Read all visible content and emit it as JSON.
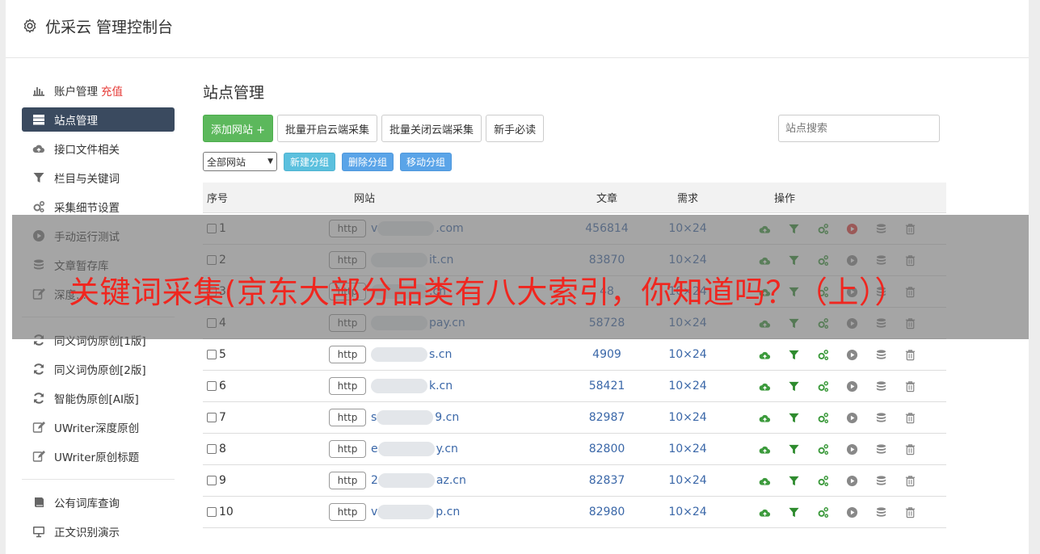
{
  "app": {
    "title": "优采云 管理控制台"
  },
  "sidebar": {
    "group1": [
      {
        "label": "账户管理",
        "extra": "充值",
        "icon": "bar-chart-icon"
      },
      {
        "label": "站点管理",
        "icon": "server-icon",
        "active": true
      },
      {
        "label": "接口文件相关",
        "icon": "cloud-icon"
      },
      {
        "label": "栏目与关键词",
        "icon": "filter-icon"
      },
      {
        "label": "采集细节设置",
        "icon": "gears-icon"
      },
      {
        "label": "手动运行测试",
        "icon": "play-icon"
      },
      {
        "label": "文章暂存库",
        "icon": "database-icon"
      },
      {
        "label": "深度...",
        "icon": "edit-icon"
      }
    ],
    "group2": [
      {
        "label": "同义词伪原创[1版]",
        "icon": "refresh-icon"
      },
      {
        "label": "同义词伪原创[2版]",
        "icon": "refresh-icon"
      },
      {
        "label": "智能伪原创[AI版]",
        "icon": "refresh-icon"
      },
      {
        "label": "UWriter深度原创",
        "icon": "edit-icon"
      },
      {
        "label": "UWriter原创标题",
        "icon": "edit-icon"
      }
    ],
    "group3": [
      {
        "label": "公有词库查询",
        "icon": "book-icon"
      },
      {
        "label": "正文识别演示",
        "icon": "monitor-icon"
      }
    ]
  },
  "main": {
    "title": "站点管理",
    "buttons": {
      "add": "添加网站 +",
      "batch_on": "批量开启云端采集",
      "batch_off": "批量关闭云端采集",
      "guide": "新手必读"
    },
    "search_placeholder": "站点搜索",
    "group_select": "全部网站",
    "group_buttons": {
      "new": "新建分组",
      "delete": "删除分组",
      "move": "移动分组"
    },
    "table": {
      "headers": {
        "idx": "序号",
        "site": "网站",
        "articles": "文章",
        "demand": "需求",
        "ops": "操作"
      },
      "rows": [
        {
          "idx": "1",
          "proto": "http",
          "domain": "v",
          "suffix": ".com",
          "articles": "456814",
          "demand": "10×24",
          "play_red": true
        },
        {
          "idx": "2",
          "proto": "http",
          "domain": "",
          "suffix": "it.cn",
          "articles": "83870",
          "demand": "10×24",
          "play_red": false
        },
        {
          "idx": "3",
          "proto": "http",
          "domain": "",
          "suffix": ".cn",
          "articles": "48",
          "demand": "10×24",
          "play_red": false
        },
        {
          "idx": "4",
          "proto": "http",
          "domain": "",
          "suffix": "pay.cn",
          "articles": "58728",
          "demand": "10×24",
          "play_red": false
        },
        {
          "idx": "5",
          "proto": "http",
          "domain": "",
          "suffix": "s.cn",
          "articles": "4909",
          "demand": "10×24",
          "play_red": false
        },
        {
          "idx": "6",
          "proto": "http",
          "domain": "",
          "suffix": "k.cn",
          "articles": "58421",
          "demand": "10×24",
          "play_red": false
        },
        {
          "idx": "7",
          "proto": "http",
          "domain": "s",
          "suffix": "9.cn",
          "articles": "82987",
          "demand": "10×24",
          "play_red": false
        },
        {
          "idx": "8",
          "proto": "http",
          "domain": "e",
          "suffix": "y.cn",
          "articles": "82800",
          "demand": "10×24",
          "play_red": false
        },
        {
          "idx": "9",
          "proto": "http",
          "domain": "2",
          "suffix": "az.cn",
          "articles": "82837",
          "demand": "10×24",
          "play_red": false
        },
        {
          "idx": "10",
          "proto": "http",
          "domain": "v",
          "suffix": "p.cn",
          "articles": "82980",
          "demand": "10×24",
          "play_red": false
        }
      ]
    }
  },
  "overlay": {
    "headline": "关键词采集(京东大部分品类有八大索引，你知道吗？（上））"
  },
  "colors": {
    "accent_green": "#5cb85c",
    "sidebar_active": "#3a4a5f",
    "link_blue": "#3a67a8",
    "headline_red": "#f0261f"
  }
}
